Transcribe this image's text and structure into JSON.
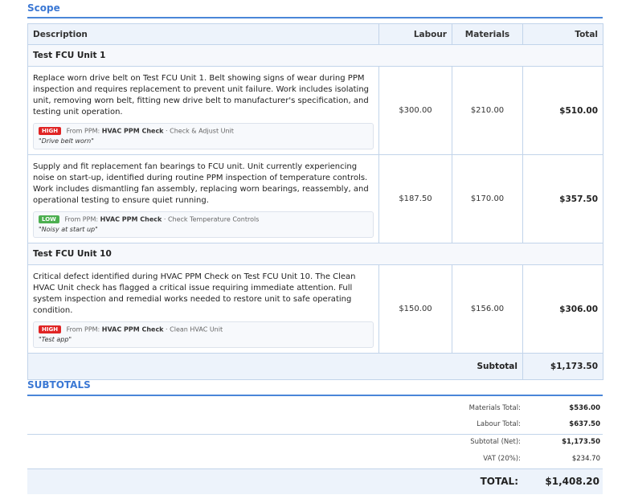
{
  "scope": {
    "title": "Scope",
    "headers": {
      "description": "Description",
      "labour": "Labour",
      "materials": "Materials",
      "total": "Total"
    },
    "groups": [
      {
        "name": "Test FCU Unit 1",
        "items": [
          {
            "description": "Replace worn drive belt on Test FCU Unit 1. Belt showing signs of wear during PPM inspection and requires replacement to prevent unit failure. Work includes isolating unit, removing worn belt, fitting new drive belt to manufacturer's specification, and testing unit operation.",
            "priority": "HIGH",
            "from_label": "From PPM:",
            "check": "HVAC PPM Check",
            "task": "· Check & Adjust Unit",
            "note": "\"Drive belt worn\"",
            "labour": "$300.00",
            "materials": "$210.00",
            "total": "$510.00"
          },
          {
            "description": "Supply and fit replacement fan bearings to FCU unit. Unit currently experiencing noise on start-up, identified during routine PPM inspection of temperature controls. Work includes dismantling fan assembly, replacing worn bearings, reassembly, and operational testing to ensure quiet running.",
            "priority": "LOW",
            "from_label": "From PPM:",
            "check": "HVAC PPM Check",
            "task": "· Check Temperature Controls",
            "note": "\"Noisy at start up\"",
            "labour": "$187.50",
            "materials": "$170.00",
            "total": "$357.50"
          }
        ]
      },
      {
        "name": "Test FCU Unit 10",
        "items": [
          {
            "description": "Critical defect identified during HVAC PPM Check on Test FCU Unit 10. The Clean HVAC Unit check has flagged a critical issue requiring immediate attention. Full system inspection and remedial works needed to restore unit to safe operating condition.",
            "priority": "HIGH",
            "from_label": "From PPM:",
            "check": "HVAC PPM Check",
            "task": "· Clean HVAC Unit",
            "note": "\"Test app\"",
            "labour": "$150.00",
            "materials": "$156.00",
            "total": "$306.00"
          }
        ]
      }
    ],
    "subtotal_label": "Subtotal",
    "subtotal_value": "$1,173.50"
  },
  "subtotals": {
    "title": "SUBTOTALS",
    "materials_label": "Materials Total:",
    "materials_value": "$536.00",
    "labour_label": "Labour Total:",
    "labour_value": "$637.50",
    "net_label": "Subtotal (Net):",
    "net_value": "$1,173.50",
    "vat_label": "VAT (20%):",
    "vat_value": "$234.70",
    "total_label": "TOTAL:",
    "total_value": "$1,408.20"
  },
  "colors": {
    "accent": "#3b78d4",
    "high": "#e02424",
    "low": "#4caf50",
    "header_bg": "#edf3fb"
  }
}
